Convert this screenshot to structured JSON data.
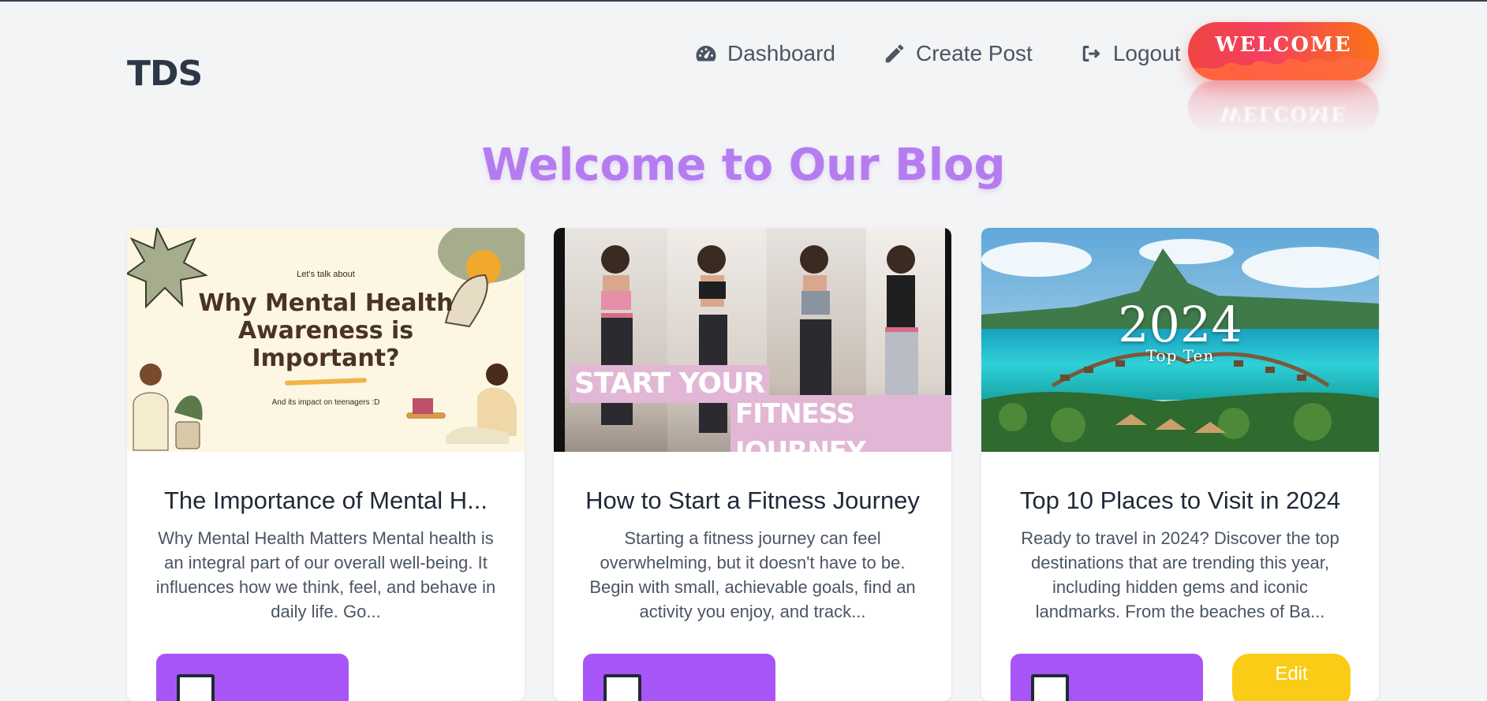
{
  "header": {
    "logo": "TDS",
    "nav": [
      {
        "label": "Dashboard",
        "icon": "dashboard-gauge-icon"
      },
      {
        "label": "Create Post",
        "icon": "pencil-icon"
      },
      {
        "label": "Logout",
        "icon": "logout-icon"
      }
    ],
    "welcome_badge": "WELCOME"
  },
  "hero": {
    "title": "Welcome to Our Blog"
  },
  "posts": [
    {
      "title": "The Importance of Mental H...",
      "excerpt": "Why Mental Health Matters Mental health is an integral part of our overall well-being. It influences how we think, feel, and behave in daily life. Go...",
      "image": {
        "kicker": "Let's talk about",
        "headline_1": "Why Mental Health",
        "headline_2": "Awareness is",
        "headline_3": "Important?",
        "sub": "And its impact on teenagers :D"
      }
    },
    {
      "title": "How to Start a Fitness Journey",
      "excerpt": "Starting a fitness journey can feel overwhelming, but it doesn't have to be. Begin with small, achievable goals, find an activity you enjoy, and track...",
      "image": {
        "label_1": "START YOUR",
        "label_2": "FITNESS JOURNEY"
      }
    },
    {
      "title": "Top 10 Places to Visit in 2024",
      "excerpt": "Ready to travel in 2024? Discover the top destinations that are trending this year, including hidden gems and iconic landmarks. From the beaches of Ba...",
      "image": {
        "year": "2024",
        "tag": "Top Ten"
      },
      "edit_label": "Edit"
    }
  ],
  "colors": {
    "accent_purple": "#a855f7",
    "hero_purple": "#b57cf0",
    "edit_yellow": "#facc15",
    "welcome_red": "#ef4444",
    "welcome_orange": "#f97316"
  }
}
